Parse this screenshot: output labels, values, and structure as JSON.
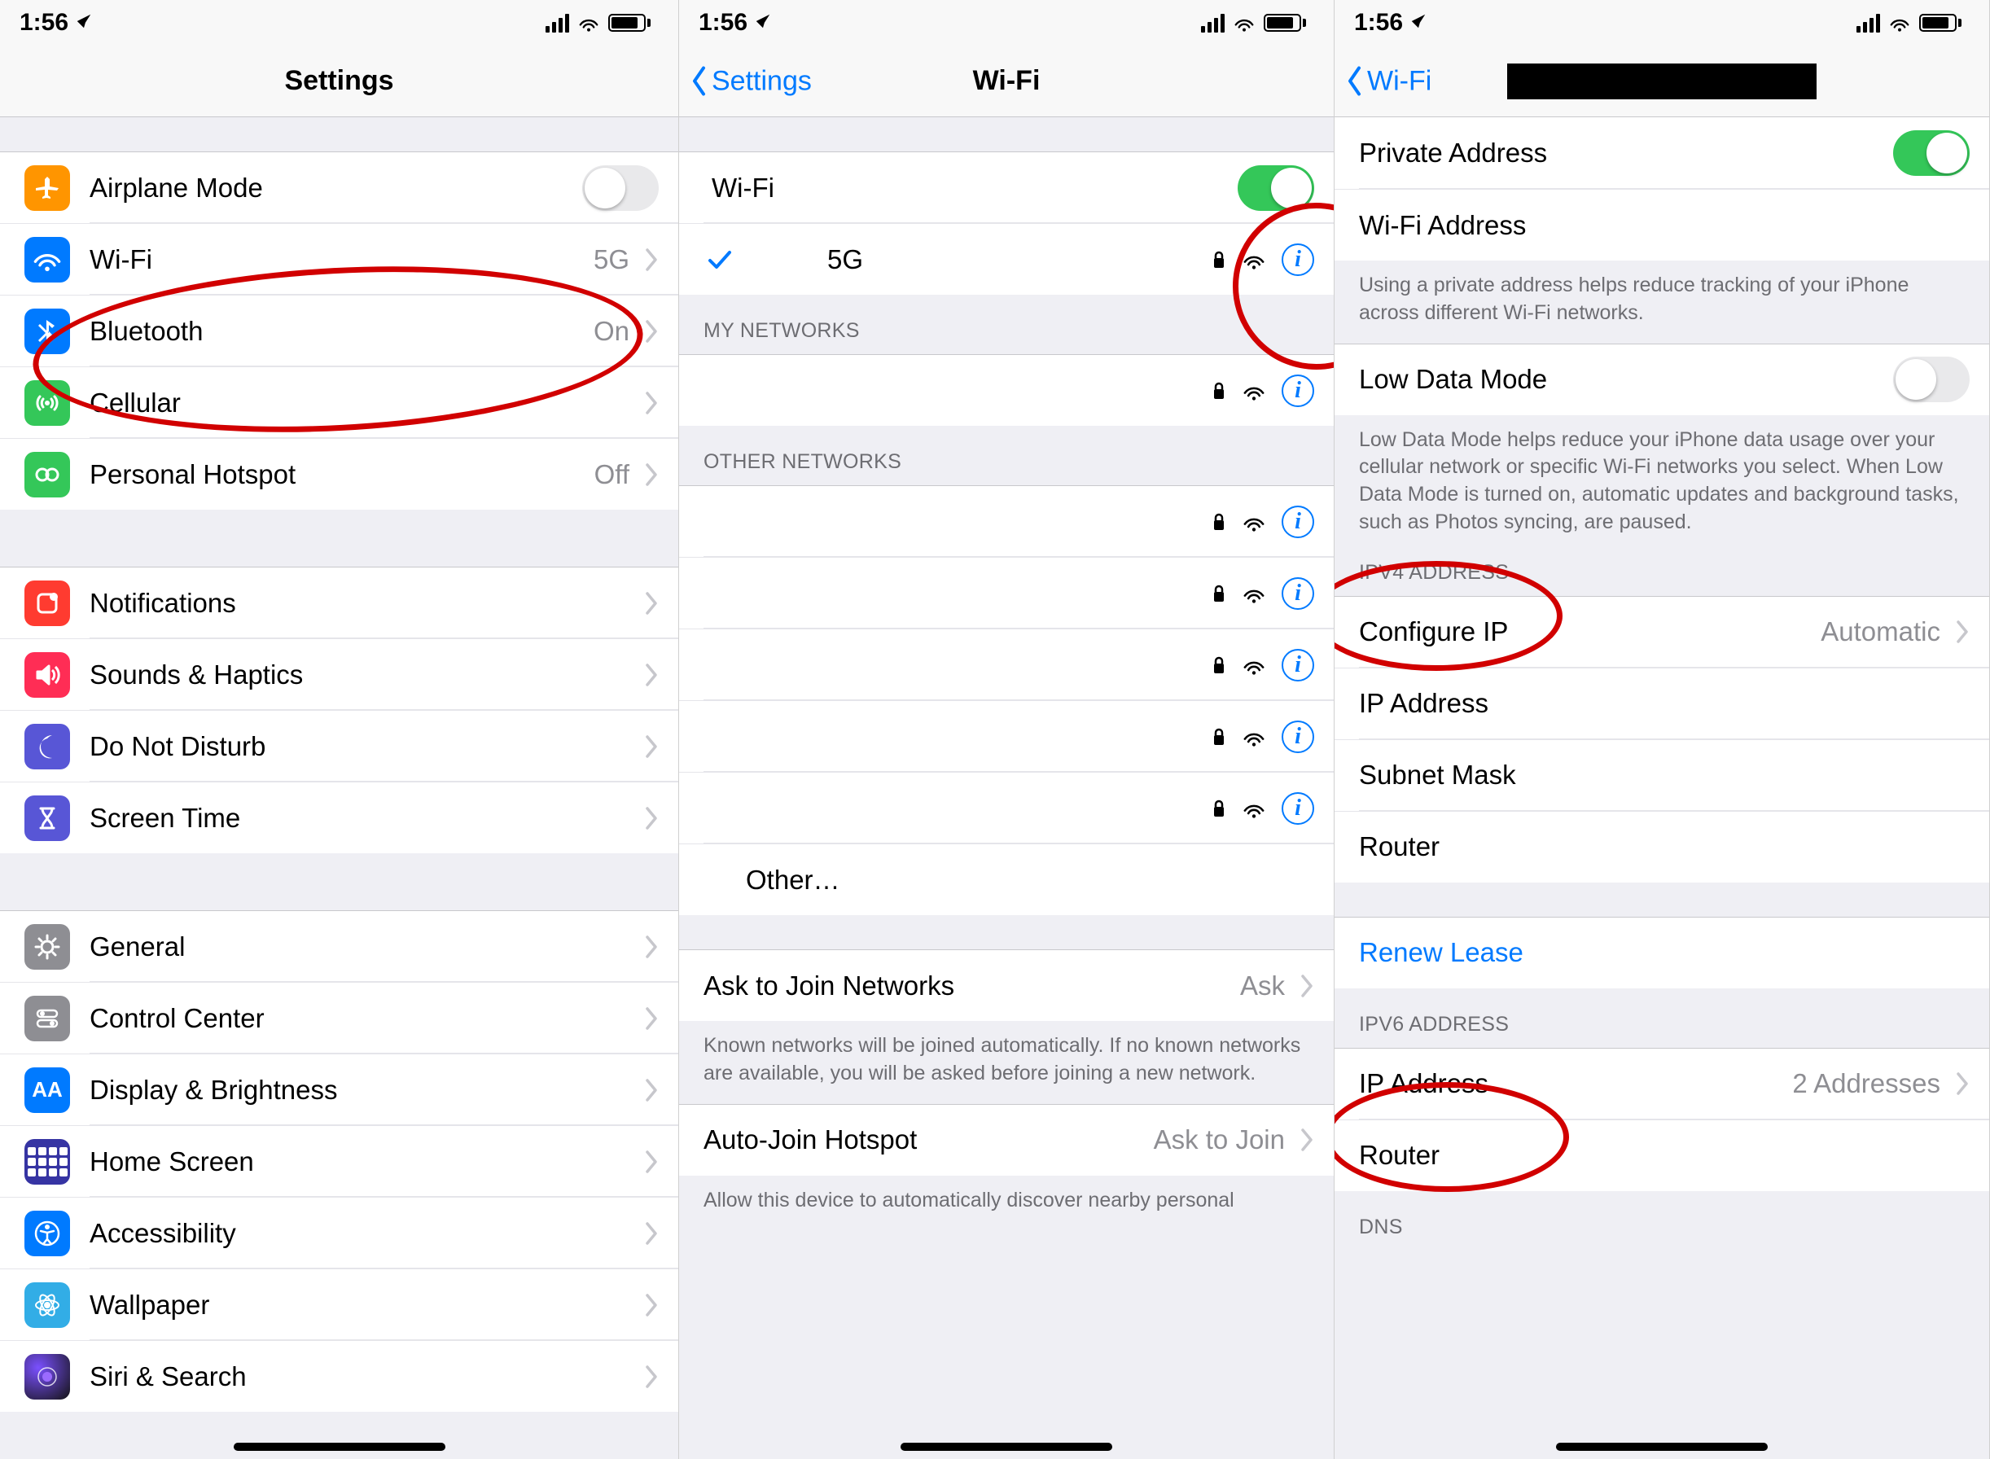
{
  "status": {
    "time": "1:56"
  },
  "panel1": {
    "title": "Settings",
    "items": {
      "airplane": "Airplane Mode",
      "wifi": "Wi-Fi",
      "wifi_val": "5G",
      "bt": "Bluetooth",
      "bt_val": "On",
      "cell": "Cellular",
      "hotspot": "Personal Hotspot",
      "hotspot_val": "Off",
      "notif": "Notifications",
      "sounds": "Sounds & Haptics",
      "dnd": "Do Not Disturb",
      "screentime": "Screen Time",
      "general": "General",
      "control": "Control Center",
      "display": "Display & Brightness",
      "home": "Home Screen",
      "access": "Accessibility",
      "wallpaper": "Wallpaper",
      "siri": "Siri & Search"
    }
  },
  "panel2": {
    "back": "Settings",
    "title": "Wi-Fi",
    "wifi_label": "Wi-Fi",
    "connected": "5G",
    "sec_my": "MY NETWORKS",
    "sec_other": "OTHER NETWORKS",
    "other_item": "Other…",
    "ask_label": "Ask to Join Networks",
    "ask_val": "Ask",
    "ask_footer": "Known networks will be joined automatically. If no known networks are available, you will be asked before joining a new network.",
    "autohs_label": "Auto-Join Hotspot",
    "autohs_val": "Ask to Join",
    "autohs_footer": "Allow this device to automatically discover nearby personal"
  },
  "panel3": {
    "back": "Wi-Fi",
    "priv_label": "Private Address",
    "wifiaddr_label": "Wi-Fi Address",
    "priv_footer": "Using a private address helps reduce tracking of your iPhone across different Wi-Fi networks.",
    "lowdata_label": "Low Data Mode",
    "lowdata_footer": "Low Data Mode helps reduce your iPhone data usage over your cellular network or specific Wi-Fi networks you select. When Low Data Mode is turned on, automatic updates and background tasks, such as Photos syncing, are paused.",
    "ipv4_header": "IPV4 ADDRESS",
    "configip": "Configure IP",
    "configip_val": "Automatic",
    "ipaddr": "IP Address",
    "subnet": "Subnet Mask",
    "router": "Router",
    "renew": "Renew Lease",
    "ipv6_header": "IPV6 ADDRESS",
    "ipv6_ip": "IP Address",
    "ipv6_ip_val": "2 Addresses",
    "ipv6_router": "Router",
    "dns_header": "DNS"
  }
}
